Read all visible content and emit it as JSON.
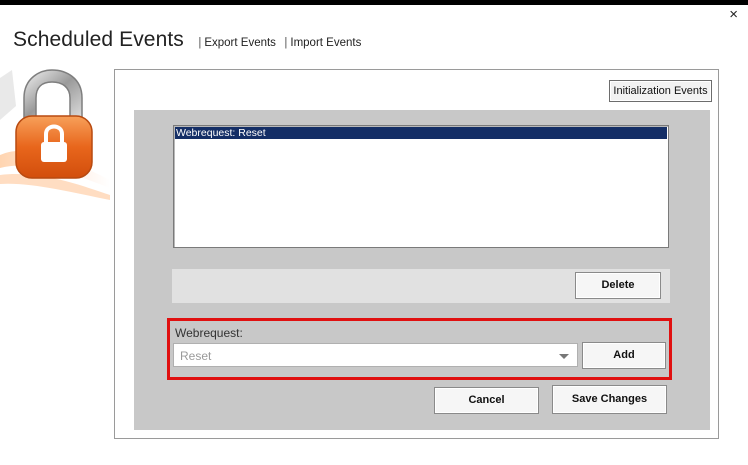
{
  "window": {
    "title": "Scheduled Events",
    "close_glyph": "×"
  },
  "header": {
    "links": [
      {
        "sep": "|",
        "label": "Export Events"
      },
      {
        "sep": "|",
        "label": "Import Events"
      }
    ]
  },
  "logo": {
    "icon": "padlock-icon"
  },
  "toolbar": {
    "init_label": "Initialization Events"
  },
  "events_list": {
    "items": [
      {
        "label": "Webrequest: Reset",
        "selected": true
      }
    ]
  },
  "actions": {
    "delete_label": "Delete",
    "add_label": "Add",
    "cancel_label": "Cancel",
    "save_label": "Save Changes"
  },
  "webrequest": {
    "label": "Webrequest:",
    "value": "Reset"
  },
  "colors": {
    "selection": "#142e66",
    "highlight_border": "#e01010",
    "panel": "#c8c8c8"
  }
}
